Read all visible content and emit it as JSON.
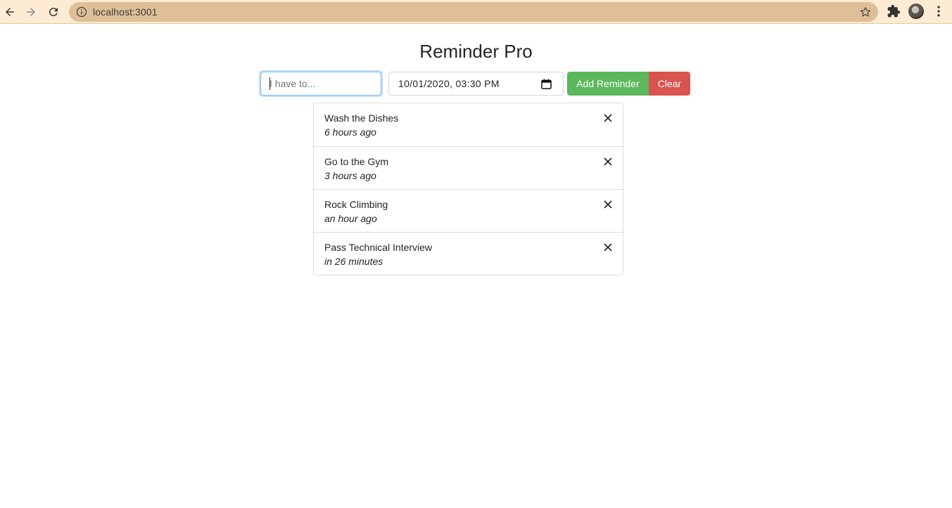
{
  "browser": {
    "url": "localhost:3001"
  },
  "app": {
    "title": "Reminder Pro"
  },
  "form": {
    "task_placeholder": "I have to...",
    "task_value": "",
    "date_value": "10/01/2020, 03:30  PM",
    "add_label": "Add Reminder",
    "clear_label": "Clear"
  },
  "reminders": [
    {
      "text": "Wash the Dishes",
      "time": "6 hours ago"
    },
    {
      "text": "Go to the Gym",
      "time": "3 hours ago"
    },
    {
      "text": "Rock Climbing",
      "time": "an hour ago"
    },
    {
      "text": "Pass Technical Interview",
      "time": "in 26 minutes"
    }
  ],
  "colors": {
    "add": "#5cb85c",
    "clear": "#d9534f",
    "chrome": "#fdecd3",
    "omnibox": "#dfbf98"
  }
}
